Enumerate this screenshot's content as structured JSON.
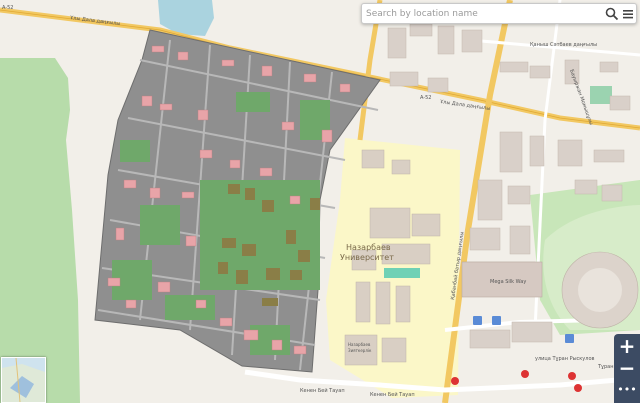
{
  "search": {
    "placeholder": "Search by location name",
    "value": ""
  },
  "labels": {
    "road_a52_west": "A-52",
    "road_a52_east": "A-52",
    "street_dala_1": "Ұлы Дала даңғылы",
    "street_dala_2": "Ұлы Дала даңғылы",
    "street_near_top": "Қаныш Сәтбаев даңғылы",
    "street_north_right": "Бауыржан Момышұлы",
    "university_line1": "Назарбаев",
    "university_line2": "Университет",
    "street_vertical": "Қабанбай батыр даңғылы",
    "street_turan_bottom": "Кенен Бей Тауап",
    "street_turan_2": "Кенен Бей Тауап",
    "street_bottom_right": "улица Тұран Рыскулов",
    "street_bottom_right2": "Тұран",
    "mall": "Mega Silk Way",
    "school_line1": "Назарбаев",
    "school_line2": "Зияткерлік"
  },
  "controls": {
    "zoom_in": "+",
    "zoom_out": "−",
    "more": "•••",
    "search_icon": "search-icon",
    "menu_icon": "hamburger-menu-icon"
  },
  "colors": {
    "base": "#f2efe9",
    "park": "#7fbf7a",
    "overlay_gray": "#8f8f8f",
    "overlay_green": "#6fa86a",
    "building_pink": "#e8a4a8",
    "university_yellow": "#fbf7c8",
    "road_yellow": "#f2c862",
    "water": "#aad3df",
    "ui_panel": "#3c4b63"
  }
}
